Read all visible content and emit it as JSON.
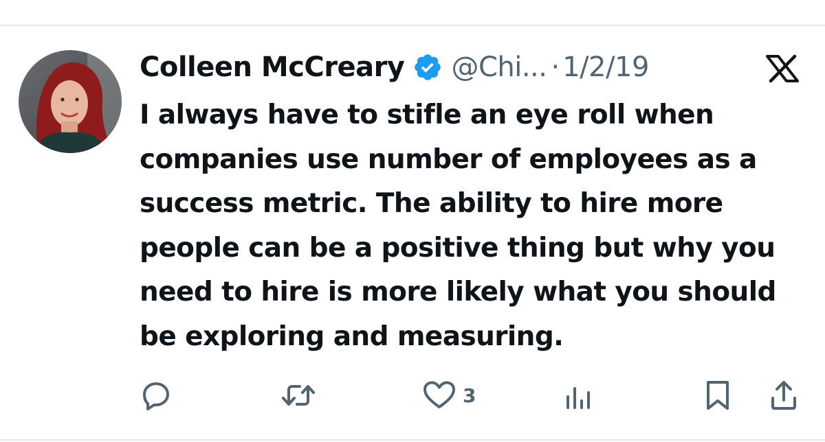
{
  "tweet": {
    "author_name": "Colleen McCreary",
    "handle": "@Chi...",
    "separator": "·",
    "date": "1/2/19",
    "text": "I always have to stifle an eye roll when companies use number of employees as a success metric. The ability to hire more people can be a positive thing but why you need to hire is more likely what you should be exploring and measuring.",
    "verified": true,
    "verified_color": "#1d9bf0"
  },
  "actions": {
    "reply": {
      "icon": "reply-icon"
    },
    "repost": {
      "icon": "repost-icon"
    },
    "like": {
      "icon": "heart-icon",
      "count": "3"
    },
    "views": {
      "icon": "views-icon"
    },
    "bookmark": {
      "icon": "bookmark-icon"
    },
    "share": {
      "icon": "share-icon"
    }
  },
  "brand": {
    "icon": "x-logo-icon"
  },
  "colors": {
    "text": "#0f1419",
    "secondary": "#536471",
    "divider": "#e4e6e8"
  }
}
